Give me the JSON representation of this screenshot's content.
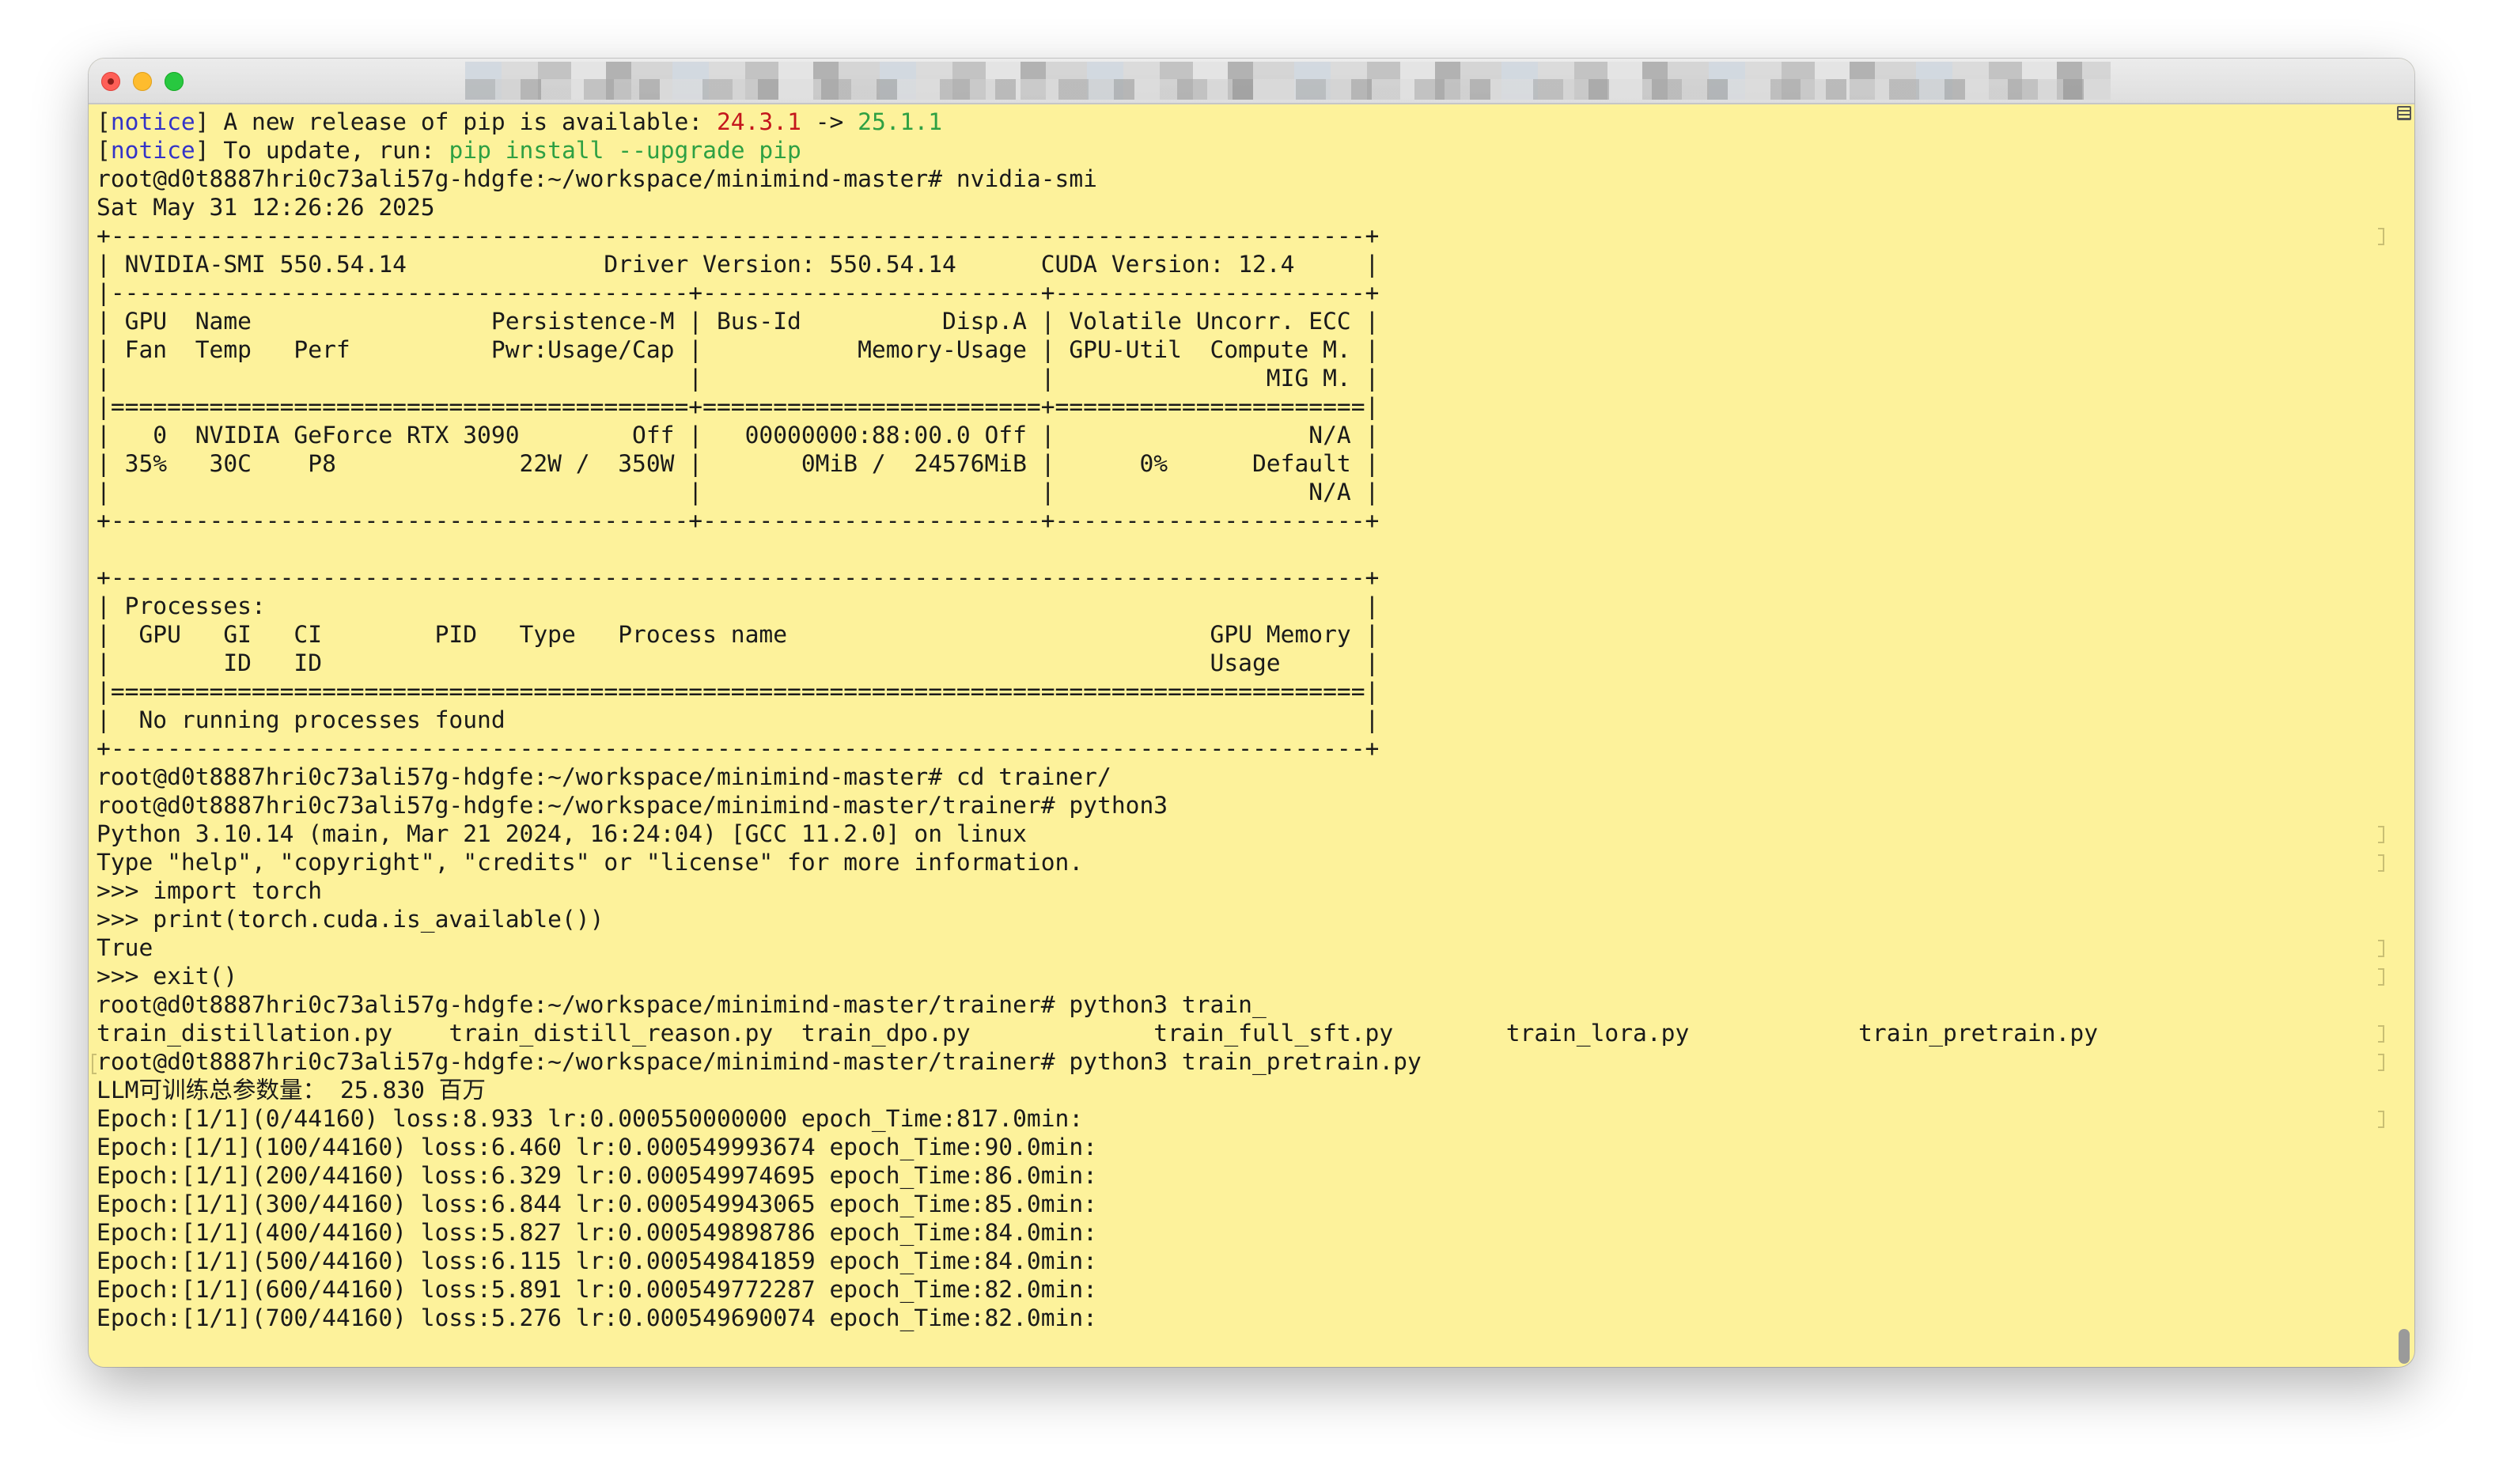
{
  "window": {
    "title_obscured": true
  },
  "terminal": {
    "pip_notice_1": {
      "tag": "notice",
      "text": " A new release of pip is available: ",
      "old_version": "24.3.1",
      "arrow": " -> ",
      "new_version": "25.1.1"
    },
    "pip_notice_2": {
      "tag": "notice",
      "text": " To update, run: ",
      "command": "pip install --upgrade pip"
    },
    "lines": [
      "root@d0t8887hri0c73ali57g-hdgfe:~/workspace/minimind-master# nvidia-smi",
      "Sat May 31 12:26:26 2025",
      "+-----------------------------------------------------------------------------------------+",
      "| NVIDIA-SMI 550.54.14              Driver Version: 550.54.14      CUDA Version: 12.4     |",
      "|-----------------------------------------+------------------------+----------------------+",
      "| GPU  Name                 Persistence-M | Bus-Id          Disp.A | Volatile Uncorr. ECC |",
      "| Fan  Temp   Perf          Pwr:Usage/Cap |           Memory-Usage | GPU-Util  Compute M. |",
      "|                                         |                        |               MIG M. |",
      "|=========================================+========================+======================|",
      "|   0  NVIDIA GeForce RTX 3090        Off |   00000000:88:00.0 Off |                  N/A |",
      "| 35%   30C    P8             22W /  350W |       0MiB /  24576MiB |      0%      Default |",
      "|                                         |                        |                  N/A |",
      "+-----------------------------------------+------------------------+----------------------+",
      "",
      "+-----------------------------------------------------------------------------------------+",
      "| Processes:                                                                              |",
      "|  GPU   GI   CI        PID   Type   Process name                              GPU Memory |",
      "|        ID   ID                                                               Usage      |",
      "|=========================================================================================|",
      "|  No running processes found                                                             |",
      "+-----------------------------------------------------------------------------------------+",
      "root@d0t8887hri0c73ali57g-hdgfe:~/workspace/minimind-master# cd trainer/",
      "root@d0t8887hri0c73ali57g-hdgfe:~/workspace/minimind-master/trainer# python3",
      "Python 3.10.14 (main, Mar 21 2024, 16:24:04) [GCC 11.2.0] on linux",
      "Type \"help\", \"copyright\", \"credits\" or \"license\" for more information.",
      ">>> import torch",
      ">>> print(torch.cuda.is_available())",
      "True",
      ">>> exit()",
      "root@d0t8887hri0c73ali57g-hdgfe:~/workspace/minimind-master/trainer# python3 train_",
      "train_distillation.py    train_distill_reason.py  train_dpo.py             train_full_sft.py        train_lora.py            train_pretrain.py",
      "root@d0t8887hri0c73ali57g-hdgfe:~/workspace/minimind-master/trainer# python3 train_pretrain.py",
      "LLM可训练总参数量： 25.830 百万",
      "Epoch:[1/1](0/44160) loss:8.933 lr:0.000550000000 epoch_Time:817.0min:",
      "Epoch:[1/1](100/44160) loss:6.460 lr:0.000549993674 epoch_Time:90.0min:",
      "Epoch:[1/1](200/44160) loss:6.329 lr:0.000549974695 epoch_Time:86.0min:",
      "Epoch:[1/1](300/44160) loss:6.844 lr:0.000549943065 epoch_Time:85.0min:",
      "Epoch:[1/1](400/44160) loss:5.827 lr:0.000549898786 epoch_Time:84.0min:",
      "Epoch:[1/1](500/44160) loss:6.115 lr:0.000549841859 epoch_Time:84.0min:",
      "Epoch:[1/1](600/44160) loss:5.891 lr:0.000549772287 epoch_Time:82.0min:",
      "Epoch:[1/1](700/44160) loss:5.276 lr:0.000549690074 epoch_Time:82.0min:"
    ]
  },
  "colors": {
    "background": "#fdf29b",
    "notice_tag": "#3333c8",
    "old_version": "#c4161c",
    "new_version": "#2ea043"
  }
}
